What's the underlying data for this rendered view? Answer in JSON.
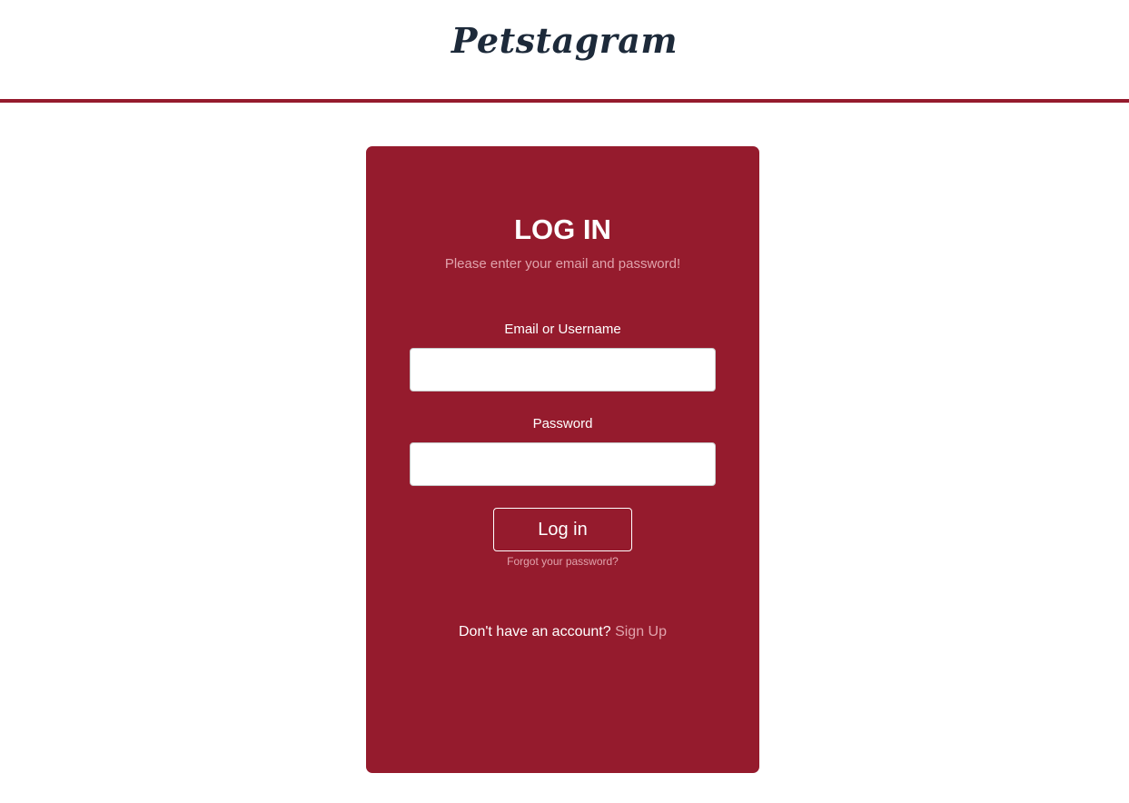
{
  "header": {
    "brand": "Petstagram"
  },
  "login_card": {
    "title": "LOG IN",
    "subtitle": "Please enter your email and password!",
    "email_label": "Email or Username",
    "email_value": "",
    "password_label": "Password",
    "password_value": "",
    "submit_label": "Log in",
    "forgot_label": "Forgot your password?",
    "signup_prompt": "Don't have an account?",
    "signup_link": "Sign Up"
  },
  "colors": {
    "accent": "#951b2d",
    "muted_text": "#e0a3ac",
    "brand_text": "#1d2a3a"
  }
}
